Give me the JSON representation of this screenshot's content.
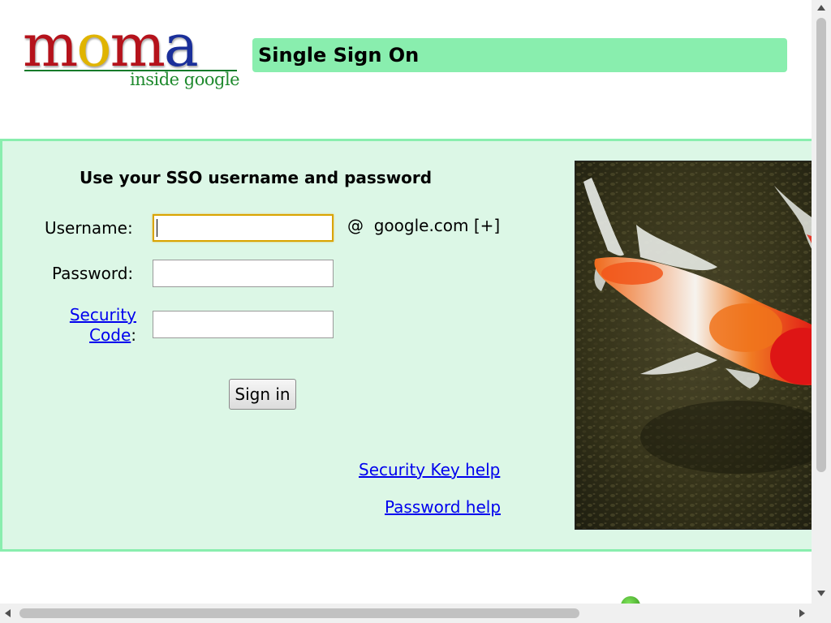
{
  "logo": {
    "letters": [
      "m",
      "o",
      "m",
      "a"
    ],
    "letter_colors": [
      "#b5121b",
      "#e0b400",
      "#b5121b",
      "#1a2f9a"
    ],
    "tagline": "inside google"
  },
  "header": {
    "title": "Single Sign On",
    "bar_color": "#89eeae"
  },
  "form": {
    "title": "Use your SSO username and password",
    "username_label": "Username:",
    "username_value": "",
    "domain_suffix": "@  google.com [+]",
    "password_label": "Password:",
    "password_value": "",
    "security_code_link_line1": "Security",
    "security_code_link_line2": "Code",
    "security_code_colon": ":",
    "security_code_value": "",
    "sign_in_label": "Sign in"
  },
  "help_links": {
    "security_key": "Security Key help",
    "password": "Password help"
  },
  "panel": {
    "background": "#dcf7e6",
    "border": "#89eeae"
  }
}
